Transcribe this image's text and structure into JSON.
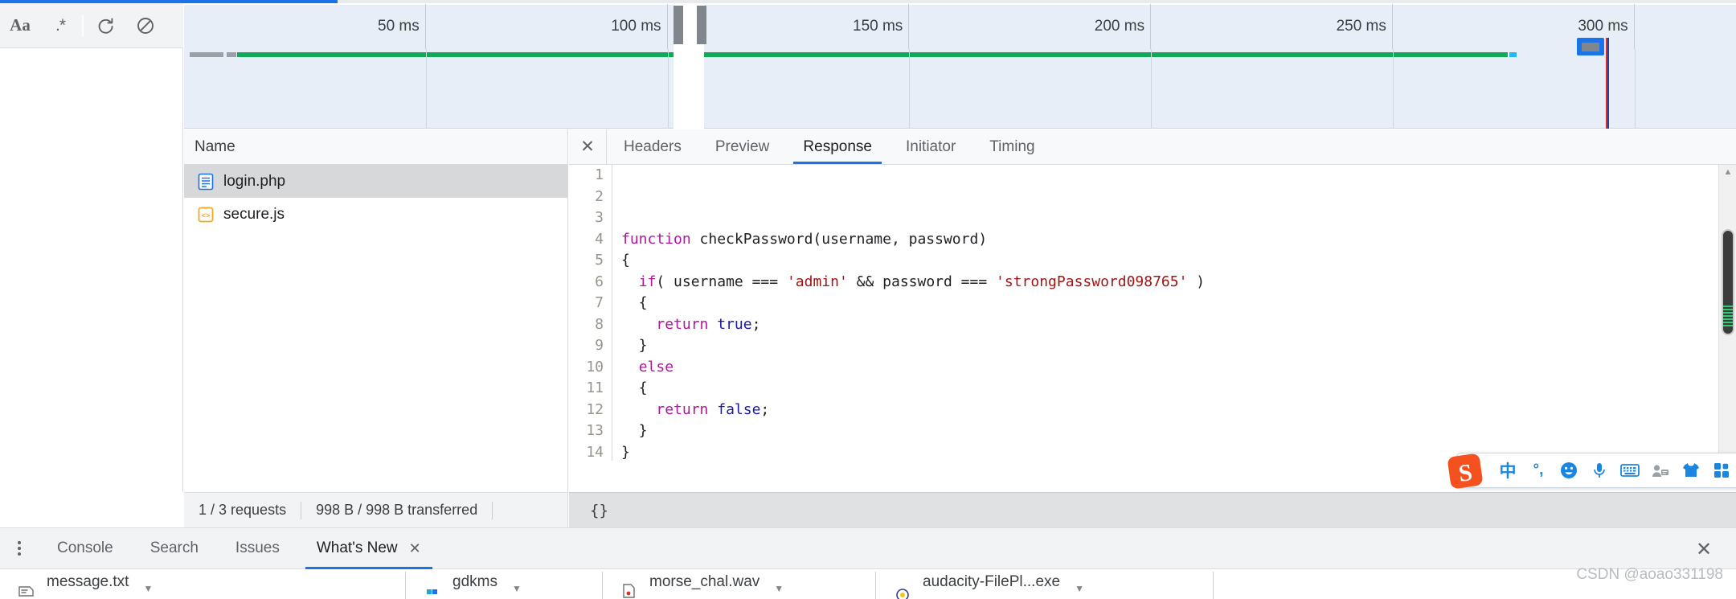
{
  "toolbar": {
    "match_case_label": "Aa",
    "regex_label": ".*",
    "reload_icon": "reload-icon",
    "clear_icon": "no-entry-icon"
  },
  "overview": {
    "ticks": [
      "50 ms",
      "100 ms",
      "150 ms",
      "200 ms",
      "250 ms",
      "300 ms"
    ],
    "selection_label": "",
    "marker_label": ""
  },
  "requests": {
    "column_header": "Name",
    "rows": [
      {
        "name": "login.php",
        "icon": "document-icon",
        "selected": true
      },
      {
        "name": "secure.js",
        "icon": "script-icon",
        "selected": false
      }
    ]
  },
  "detail": {
    "close_label": "✕",
    "tabs": [
      {
        "label": "Headers",
        "active": false
      },
      {
        "label": "Preview",
        "active": false
      },
      {
        "label": "Response",
        "active": true
      },
      {
        "label": "Initiator",
        "active": false
      },
      {
        "label": "Timing",
        "active": false
      }
    ]
  },
  "code": {
    "lines": [
      {
        "n": "1",
        "parts": []
      },
      {
        "n": "2",
        "parts": []
      },
      {
        "n": "3",
        "parts": []
      },
      {
        "n": "4",
        "parts": [
          {
            "t": "function",
            "c": "kw"
          },
          {
            "t": " checkPassword(username, password)",
            "c": ""
          }
        ]
      },
      {
        "n": "5",
        "parts": [
          {
            "t": "{",
            "c": ""
          }
        ]
      },
      {
        "n": "6",
        "parts": [
          {
            "t": "  ",
            "c": ""
          },
          {
            "t": "if",
            "c": "kw"
          },
          {
            "t": "( username === ",
            "c": ""
          },
          {
            "t": "'admin'",
            "c": "str"
          },
          {
            "t": " && password === ",
            "c": ""
          },
          {
            "t": "'strongPassword098765'",
            "c": "str"
          },
          {
            "t": " )",
            "c": ""
          }
        ]
      },
      {
        "n": "7",
        "parts": [
          {
            "t": "  {",
            "c": ""
          }
        ]
      },
      {
        "n": "8",
        "parts": [
          {
            "t": "    ",
            "c": ""
          },
          {
            "t": "return",
            "c": "kw"
          },
          {
            "t": " ",
            "c": ""
          },
          {
            "t": "true",
            "c": "bool"
          },
          {
            "t": ";",
            "c": ""
          }
        ]
      },
      {
        "n": "9",
        "parts": [
          {
            "t": "  }",
            "c": ""
          }
        ]
      },
      {
        "n": "10",
        "parts": [
          {
            "t": "  ",
            "c": ""
          },
          {
            "t": "else",
            "c": "kw"
          }
        ]
      },
      {
        "n": "11",
        "parts": [
          {
            "t": "  {",
            "c": ""
          }
        ]
      },
      {
        "n": "12",
        "parts": [
          {
            "t": "    ",
            "c": ""
          },
          {
            "t": "return",
            "c": "kw"
          },
          {
            "t": " ",
            "c": ""
          },
          {
            "t": "false",
            "c": "bool"
          },
          {
            "t": ";",
            "c": ""
          }
        ]
      },
      {
        "n": "13",
        "parts": [
          {
            "t": "  }",
            "c": ""
          }
        ]
      },
      {
        "n": "14",
        "parts": [
          {
            "t": "}",
            "c": ""
          }
        ]
      }
    ]
  },
  "status": {
    "requests": "1 / 3 requests",
    "transferred": "998 B / 998 B transferred",
    "format_braces": "{}"
  },
  "drawer": {
    "tabs": [
      {
        "label": "Console",
        "active": false,
        "closable": false
      },
      {
        "label": "Search",
        "active": false,
        "closable": false
      },
      {
        "label": "Issues",
        "active": false,
        "closable": false
      },
      {
        "label": "What's New",
        "active": true,
        "closable": true
      }
    ],
    "tab_close_label": "✕",
    "drawer_close_label": "✕"
  },
  "downloads": [
    {
      "name": "message.txt",
      "sub": "",
      "icon": "text-file-icon"
    },
    {
      "name": "gdkms",
      "sub": "",
      "icon": "generic-file-icon"
    },
    {
      "name": "morse_chal.wav",
      "sub": "",
      "icon": "audio-file-icon"
    },
    {
      "name": "audacity-FilePl...exe",
      "sub": "",
      "icon": "installer-file-icon"
    }
  ],
  "ime": {
    "logo": "sogou-logo-icon",
    "buttons": [
      "chinese-mode-icon",
      "punctuation-icon",
      "emoji-icon",
      "voice-input-icon",
      "soft-keyboard-icon",
      "user-card-icon",
      "skin-icon",
      "toolbox-icon"
    ]
  },
  "watermark": {
    "text": "CSDN @aoao331198"
  },
  "colors": {
    "accent": "#1a73e8",
    "network_green": "#0fa958",
    "string_red": "#a31515",
    "keyword_magenta": "#b0159b",
    "bool_blue": "#1a1aa6",
    "overview_bg": "#e8eef7"
  }
}
